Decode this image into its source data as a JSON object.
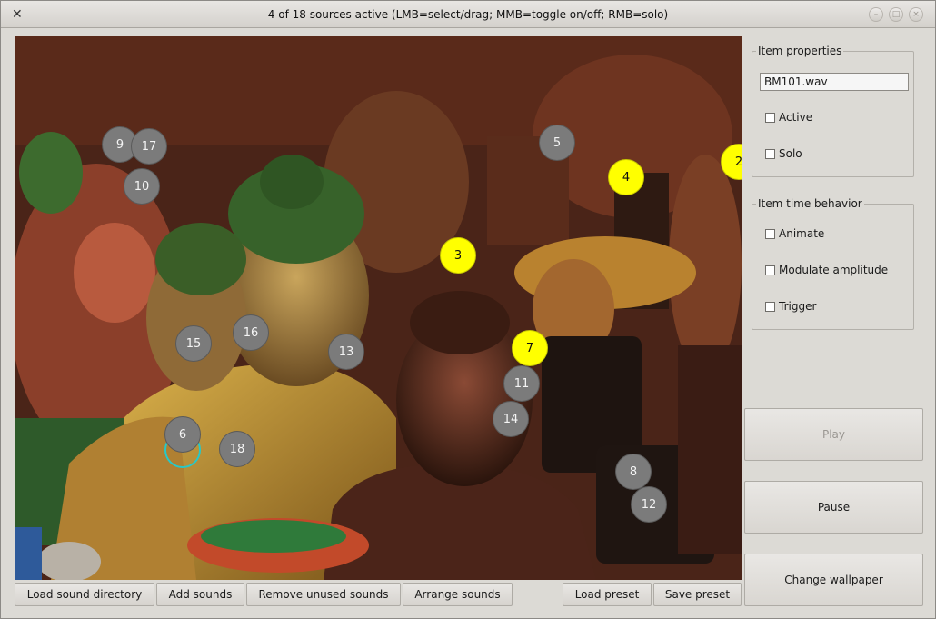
{
  "window": {
    "title": "4 of 18 sources active (LMB=select/drag; MMB=toggle on/off; RMB=solo)",
    "app_icon": "x-tools-icon"
  },
  "sources": [
    {
      "id": "9",
      "active": false
    },
    {
      "id": "17",
      "active": false
    },
    {
      "id": "10",
      "active": false
    },
    {
      "id": "5",
      "active": false
    },
    {
      "id": "4",
      "active": true
    },
    {
      "id": "2",
      "active": true
    },
    {
      "id": "3",
      "active": true
    },
    {
      "id": "16",
      "active": false
    },
    {
      "id": "15",
      "active": false
    },
    {
      "id": "13",
      "active": false
    },
    {
      "id": "7",
      "active": true
    },
    {
      "id": "11",
      "active": false
    },
    {
      "id": "14",
      "active": false
    },
    {
      "id": "6",
      "active": false,
      "selected": true
    },
    {
      "id": "18",
      "active": false
    },
    {
      "id": "8",
      "active": false
    },
    {
      "id": "12",
      "active": false
    }
  ],
  "item_properties": {
    "title": "Item properties",
    "file_name": "BM101.wav",
    "active_label": "Active",
    "active_checked": false,
    "solo_label": "Solo",
    "solo_checked": false
  },
  "item_time_behavior": {
    "title": "Item time behavior",
    "animate_label": "Animate",
    "modulate_label": "Modulate amplitude",
    "trigger_label": "Trigger"
  },
  "side_buttons": {
    "play": "Play",
    "pause": "Pause",
    "change_wallpaper": "Change wallpaper"
  },
  "bottom_buttons": {
    "load_dir": "Load sound directory",
    "add": "Add sounds",
    "remove_unused": "Remove unused sounds",
    "arrange": "Arrange sounds",
    "load_preset": "Load preset",
    "save_preset": "Save preset"
  },
  "colors": {
    "active_source": "#ffff00",
    "inactive_source": "#7b7b7b",
    "selected_ring": "#27c8c8"
  }
}
